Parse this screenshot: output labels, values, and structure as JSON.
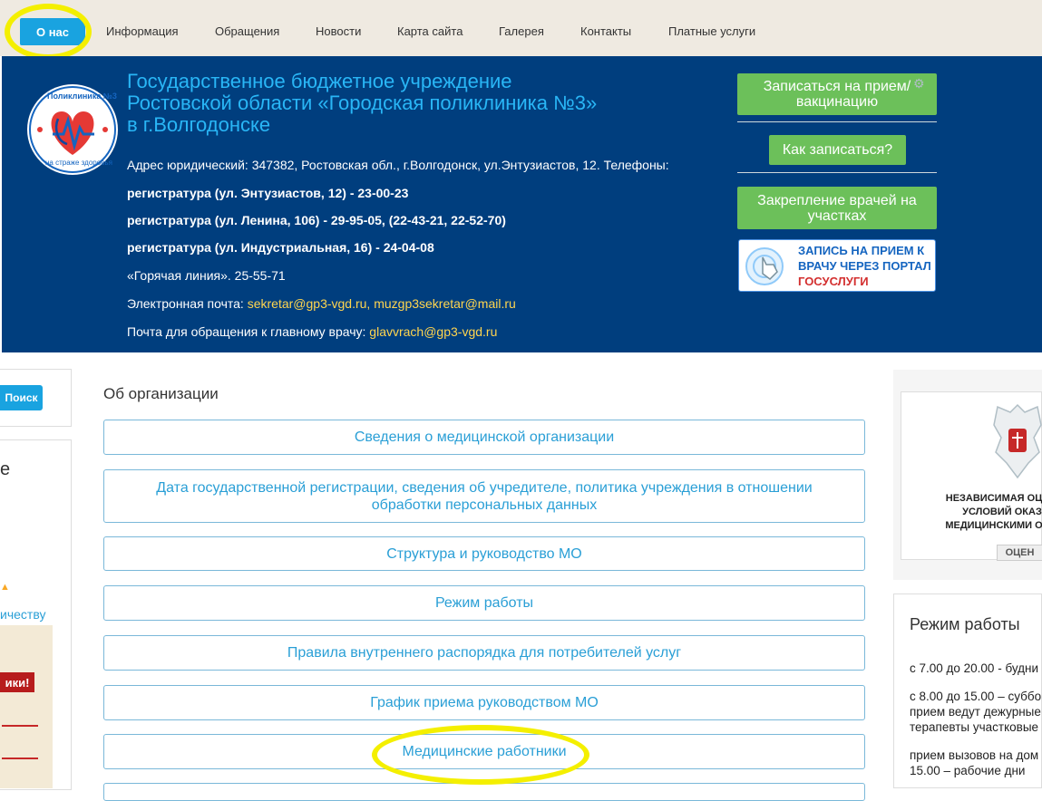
{
  "nav": {
    "active": "О нас",
    "items": [
      "Информация",
      "Обращения",
      "Новости",
      "Карта сайта",
      "Галерея",
      "Контакты",
      "Платные услуги"
    ]
  },
  "header": {
    "org_lines": [
      "Государственное бюджетное учреждение",
      "Ростовской области «Городская поликлиника №3»",
      "в г.Волгодонске"
    ],
    "logo_top": "Поликлиника №3",
    "logo_bottom": "на страже здоровья",
    "address": "Адрес юридический: 347382, Ростовская обл., г.Волгодонск, ул.Энтузиастов, 12. Телефоны:",
    "phone1": "регистратура (ул. Энтузиастов, 12) - 23-00-23",
    "phone2": "регистратура (ул. Ленина, 106) - 29-95-05, (22-43-21, 22-52-70)",
    "phone3": "регистратура (ул. Индустриальная, 16) - 24-04-08",
    "hotline": "«Горячая линия». 25-55-71",
    "email_label": "Электронная почта:",
    "email1": "sekretar@gp3-vgd.ru,",
    "email2": "muzgp3sekretar@mail.ru",
    "chief_label": "Почта для обращения к главному врачу:",
    "chief_email": "glavvrach@gp3-vgd.ru",
    "btn_appointment": "Записаться на прием/ вакцинацию",
    "btn_how": "Как записаться?",
    "btn_assign": "Закрепление врачей на участках",
    "gos_line1": "ЗАПИСЬ НА ПРИЕМ К",
    "gos_line2": "ВРАЧУ ЧЕРЕЗ ПОРТАЛ",
    "gos_line3": "ГОСУСЛУГИ"
  },
  "left": {
    "search_label": "Поиск",
    "fragment_e": "е",
    "fragment_link": "ичеству",
    "poster_text": "ики!"
  },
  "main": {
    "title": "Об организации",
    "links": [
      "Сведения о медицинской организации",
      "Дата государственной регистрации, сведения об учредителе, политика учреждения в отношении обработки персональных данных",
      "Структура и руководство МО",
      "Режим работы",
      "Правила внутреннего распорядка для потребителей услуг",
      "График приема руководством МО",
      "Медицинские работники"
    ]
  },
  "right": {
    "ind_line1": "НЕЗАВИСИМАЯ ОЦ",
    "ind_line2": "УСЛОВИЙ ОКАЗ",
    "ind_line3": "МЕДИЦИНСКИМИ О",
    "ind_button": "ОЦЕН",
    "schedule_title": "Режим работы",
    "s1": "с 7.00 до 20.00 - будни",
    "s2a": "с 8.00 до 15.00 – суббо",
    "s2b": "прием ведут дежурные",
    "s2c": "терапевты участковые",
    "s3a": "прием вызовов на дом",
    "s3b": "15.00 – рабочие дни"
  },
  "colors": {
    "accent": "#19a3e0",
    "header_bg": "#003e7e",
    "green_button": "#6cc05a",
    "highlight": "#f4ef00"
  }
}
